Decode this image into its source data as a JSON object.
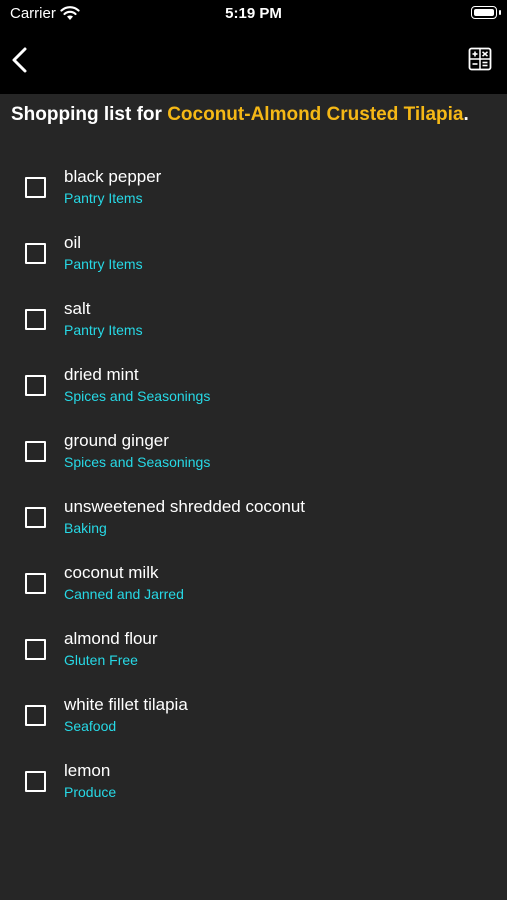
{
  "status_bar": {
    "carrier": "Carrier",
    "time": "5:19 PM"
  },
  "nav": {
    "back_icon": "chevron-left-icon",
    "calculator_icon": "calculator-icon"
  },
  "heading": {
    "prefix": "Shopping list for ",
    "recipe": "Coconut-Almond Crusted Tilapia",
    "suffix": ".",
    "recipe_color": "#f5b816"
  },
  "colors": {
    "background": "#262626",
    "topbar": "#000000",
    "category": "#27d9e6"
  },
  "items": [
    {
      "name": "black pepper",
      "category": "Pantry Items",
      "checked": false
    },
    {
      "name": "oil",
      "category": "Pantry Items",
      "checked": false
    },
    {
      "name": "salt",
      "category": "Pantry Items",
      "checked": false
    },
    {
      "name": "dried mint",
      "category": "Spices and Seasonings",
      "checked": false
    },
    {
      "name": "ground ginger",
      "category": "Spices and Seasonings",
      "checked": false
    },
    {
      "name": "unsweetened shredded coconut",
      "category": "Baking",
      "checked": false
    },
    {
      "name": "coconut milk",
      "category": "Canned and Jarred",
      "checked": false
    },
    {
      "name": "almond flour",
      "category": "Gluten Free",
      "checked": false
    },
    {
      "name": "white fillet tilapia",
      "category": "Seafood",
      "checked": false
    },
    {
      "name": "lemon",
      "category": "Produce",
      "checked": false
    }
  ]
}
